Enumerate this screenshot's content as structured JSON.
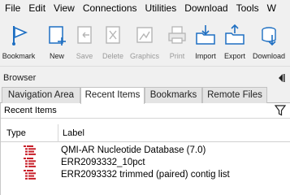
{
  "menubar": {
    "items": [
      "File",
      "Edit",
      "View",
      "Connections",
      "Utilities",
      "Download",
      "Tools",
      "W"
    ]
  },
  "toolbar": {
    "buttons": [
      {
        "label": "Bookmark",
        "icon": "bookmark-flag-icon",
        "enabled": true
      },
      {
        "label": "New",
        "icon": "new-document-icon",
        "enabled": true
      },
      {
        "label": "Save",
        "icon": "save-arrow-icon",
        "enabled": false
      },
      {
        "label": "Delete",
        "icon": "delete-document-icon",
        "enabled": false
      },
      {
        "label": "Graphics",
        "icon": "graphics-icon",
        "enabled": false
      },
      {
        "label": "Print",
        "icon": "printer-icon",
        "enabled": false
      },
      {
        "label": "Import",
        "icon": "import-folder-icon",
        "enabled": true
      },
      {
        "label": "Export",
        "icon": "export-folder-icon",
        "enabled": true
      },
      {
        "label": "Download",
        "icon": "download-cloud-icon",
        "enabled": true
      }
    ]
  },
  "browser": {
    "title": "Browser",
    "tabs": [
      {
        "label": "Navigation Area",
        "active": false
      },
      {
        "label": "Recent Items",
        "active": true
      },
      {
        "label": "Bookmarks",
        "active": false
      },
      {
        "label": "Remote Files",
        "active": false
      }
    ],
    "panel_title": "Recent Items",
    "columns": {
      "type": "Type",
      "label": "Label"
    },
    "rows": [
      {
        "label": "QMI-AR Nucleotide Database (7.0)",
        "type_icon": "sequence-list-icon"
      },
      {
        "label": "ERR2093332_10pct",
        "type_icon": "sequence-list-icon"
      },
      {
        "label": "ERR2093332 trimmed (paired) contig list",
        "type_icon": "sequence-list-icon"
      }
    ]
  },
  "colors": {
    "accent_blue": "#1e6fc2",
    "type_icon_red": "#c8202a",
    "disabled_gray": "#9a9a9a"
  }
}
